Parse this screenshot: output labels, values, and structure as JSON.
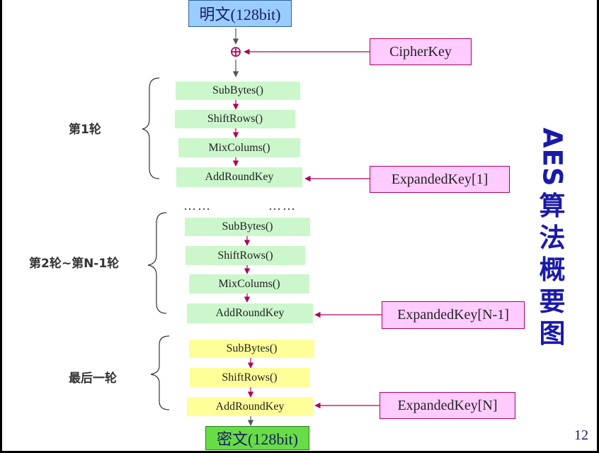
{
  "plaintext": "明文(128bit)",
  "ciphertext": "密文(128bit)",
  "xor_symbol": "⊕",
  "cipher_key": "CipherKey",
  "round1": {
    "label": "第1轮",
    "steps": [
      "SubBytes()",
      "ShiftRows()",
      "MixColums()",
      "AddRoundKey"
    ],
    "key": "ExpandedKey[1]"
  },
  "ellipsis": [
    "……",
    "……"
  ],
  "middle_rounds": {
    "label": "第2轮~第N-1轮",
    "steps": [
      "SubBytes()",
      "ShiftRows()",
      "MixColums()",
      "AddRoundKey"
    ],
    "key": "ExpandedKey[N-1]"
  },
  "final_round": {
    "label": "最后一轮",
    "steps": [
      "SubBytes()",
      "ShiftRows()",
      "AddRoundKey"
    ],
    "key": "ExpandedKey[N]"
  },
  "title": {
    "latin": "AES",
    "chinese": [
      "算",
      "法",
      "概",
      "要",
      "图"
    ]
  },
  "page_number": "12",
  "colors": {
    "plaintext_box": "#99ccff",
    "ciphertext_box": "#66dd44",
    "step_green": "#ccf7cc",
    "step_yellow": "#ffff99",
    "key_box": "#ffccff",
    "arrow": "#b0005a",
    "title": "#1a1aaa"
  }
}
